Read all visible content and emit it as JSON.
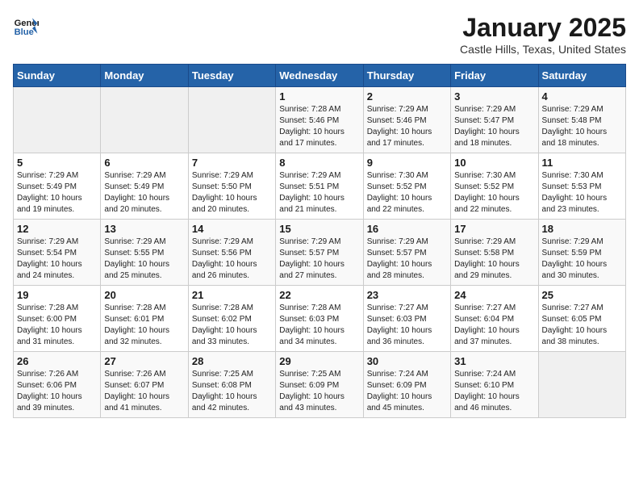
{
  "header": {
    "logo_line1": "General",
    "logo_line2": "Blue",
    "title": "January 2025",
    "subtitle": "Castle Hills, Texas, United States"
  },
  "days_of_week": [
    "Sunday",
    "Monday",
    "Tuesday",
    "Wednesday",
    "Thursday",
    "Friday",
    "Saturday"
  ],
  "weeks": [
    [
      {
        "day": "",
        "info": ""
      },
      {
        "day": "",
        "info": ""
      },
      {
        "day": "",
        "info": ""
      },
      {
        "day": "1",
        "info": "Sunrise: 7:28 AM\nSunset: 5:46 PM\nDaylight: 10 hours\nand 17 minutes."
      },
      {
        "day": "2",
        "info": "Sunrise: 7:29 AM\nSunset: 5:46 PM\nDaylight: 10 hours\nand 17 minutes."
      },
      {
        "day": "3",
        "info": "Sunrise: 7:29 AM\nSunset: 5:47 PM\nDaylight: 10 hours\nand 18 minutes."
      },
      {
        "day": "4",
        "info": "Sunrise: 7:29 AM\nSunset: 5:48 PM\nDaylight: 10 hours\nand 18 minutes."
      }
    ],
    [
      {
        "day": "5",
        "info": "Sunrise: 7:29 AM\nSunset: 5:49 PM\nDaylight: 10 hours\nand 19 minutes."
      },
      {
        "day": "6",
        "info": "Sunrise: 7:29 AM\nSunset: 5:49 PM\nDaylight: 10 hours\nand 20 minutes."
      },
      {
        "day": "7",
        "info": "Sunrise: 7:29 AM\nSunset: 5:50 PM\nDaylight: 10 hours\nand 20 minutes."
      },
      {
        "day": "8",
        "info": "Sunrise: 7:29 AM\nSunset: 5:51 PM\nDaylight: 10 hours\nand 21 minutes."
      },
      {
        "day": "9",
        "info": "Sunrise: 7:30 AM\nSunset: 5:52 PM\nDaylight: 10 hours\nand 22 minutes."
      },
      {
        "day": "10",
        "info": "Sunrise: 7:30 AM\nSunset: 5:52 PM\nDaylight: 10 hours\nand 22 minutes."
      },
      {
        "day": "11",
        "info": "Sunrise: 7:30 AM\nSunset: 5:53 PM\nDaylight: 10 hours\nand 23 minutes."
      }
    ],
    [
      {
        "day": "12",
        "info": "Sunrise: 7:29 AM\nSunset: 5:54 PM\nDaylight: 10 hours\nand 24 minutes."
      },
      {
        "day": "13",
        "info": "Sunrise: 7:29 AM\nSunset: 5:55 PM\nDaylight: 10 hours\nand 25 minutes."
      },
      {
        "day": "14",
        "info": "Sunrise: 7:29 AM\nSunset: 5:56 PM\nDaylight: 10 hours\nand 26 minutes."
      },
      {
        "day": "15",
        "info": "Sunrise: 7:29 AM\nSunset: 5:57 PM\nDaylight: 10 hours\nand 27 minutes."
      },
      {
        "day": "16",
        "info": "Sunrise: 7:29 AM\nSunset: 5:57 PM\nDaylight: 10 hours\nand 28 minutes."
      },
      {
        "day": "17",
        "info": "Sunrise: 7:29 AM\nSunset: 5:58 PM\nDaylight: 10 hours\nand 29 minutes."
      },
      {
        "day": "18",
        "info": "Sunrise: 7:29 AM\nSunset: 5:59 PM\nDaylight: 10 hours\nand 30 minutes."
      }
    ],
    [
      {
        "day": "19",
        "info": "Sunrise: 7:28 AM\nSunset: 6:00 PM\nDaylight: 10 hours\nand 31 minutes."
      },
      {
        "day": "20",
        "info": "Sunrise: 7:28 AM\nSunset: 6:01 PM\nDaylight: 10 hours\nand 32 minutes."
      },
      {
        "day": "21",
        "info": "Sunrise: 7:28 AM\nSunset: 6:02 PM\nDaylight: 10 hours\nand 33 minutes."
      },
      {
        "day": "22",
        "info": "Sunrise: 7:28 AM\nSunset: 6:03 PM\nDaylight: 10 hours\nand 34 minutes."
      },
      {
        "day": "23",
        "info": "Sunrise: 7:27 AM\nSunset: 6:03 PM\nDaylight: 10 hours\nand 36 minutes."
      },
      {
        "day": "24",
        "info": "Sunrise: 7:27 AM\nSunset: 6:04 PM\nDaylight: 10 hours\nand 37 minutes."
      },
      {
        "day": "25",
        "info": "Sunrise: 7:27 AM\nSunset: 6:05 PM\nDaylight: 10 hours\nand 38 minutes."
      }
    ],
    [
      {
        "day": "26",
        "info": "Sunrise: 7:26 AM\nSunset: 6:06 PM\nDaylight: 10 hours\nand 39 minutes."
      },
      {
        "day": "27",
        "info": "Sunrise: 7:26 AM\nSunset: 6:07 PM\nDaylight: 10 hours\nand 41 minutes."
      },
      {
        "day": "28",
        "info": "Sunrise: 7:25 AM\nSunset: 6:08 PM\nDaylight: 10 hours\nand 42 minutes."
      },
      {
        "day": "29",
        "info": "Sunrise: 7:25 AM\nSunset: 6:09 PM\nDaylight: 10 hours\nand 43 minutes."
      },
      {
        "day": "30",
        "info": "Sunrise: 7:24 AM\nSunset: 6:09 PM\nDaylight: 10 hours\nand 45 minutes."
      },
      {
        "day": "31",
        "info": "Sunrise: 7:24 AM\nSunset: 6:10 PM\nDaylight: 10 hours\nand 46 minutes."
      },
      {
        "day": "",
        "info": ""
      }
    ]
  ]
}
